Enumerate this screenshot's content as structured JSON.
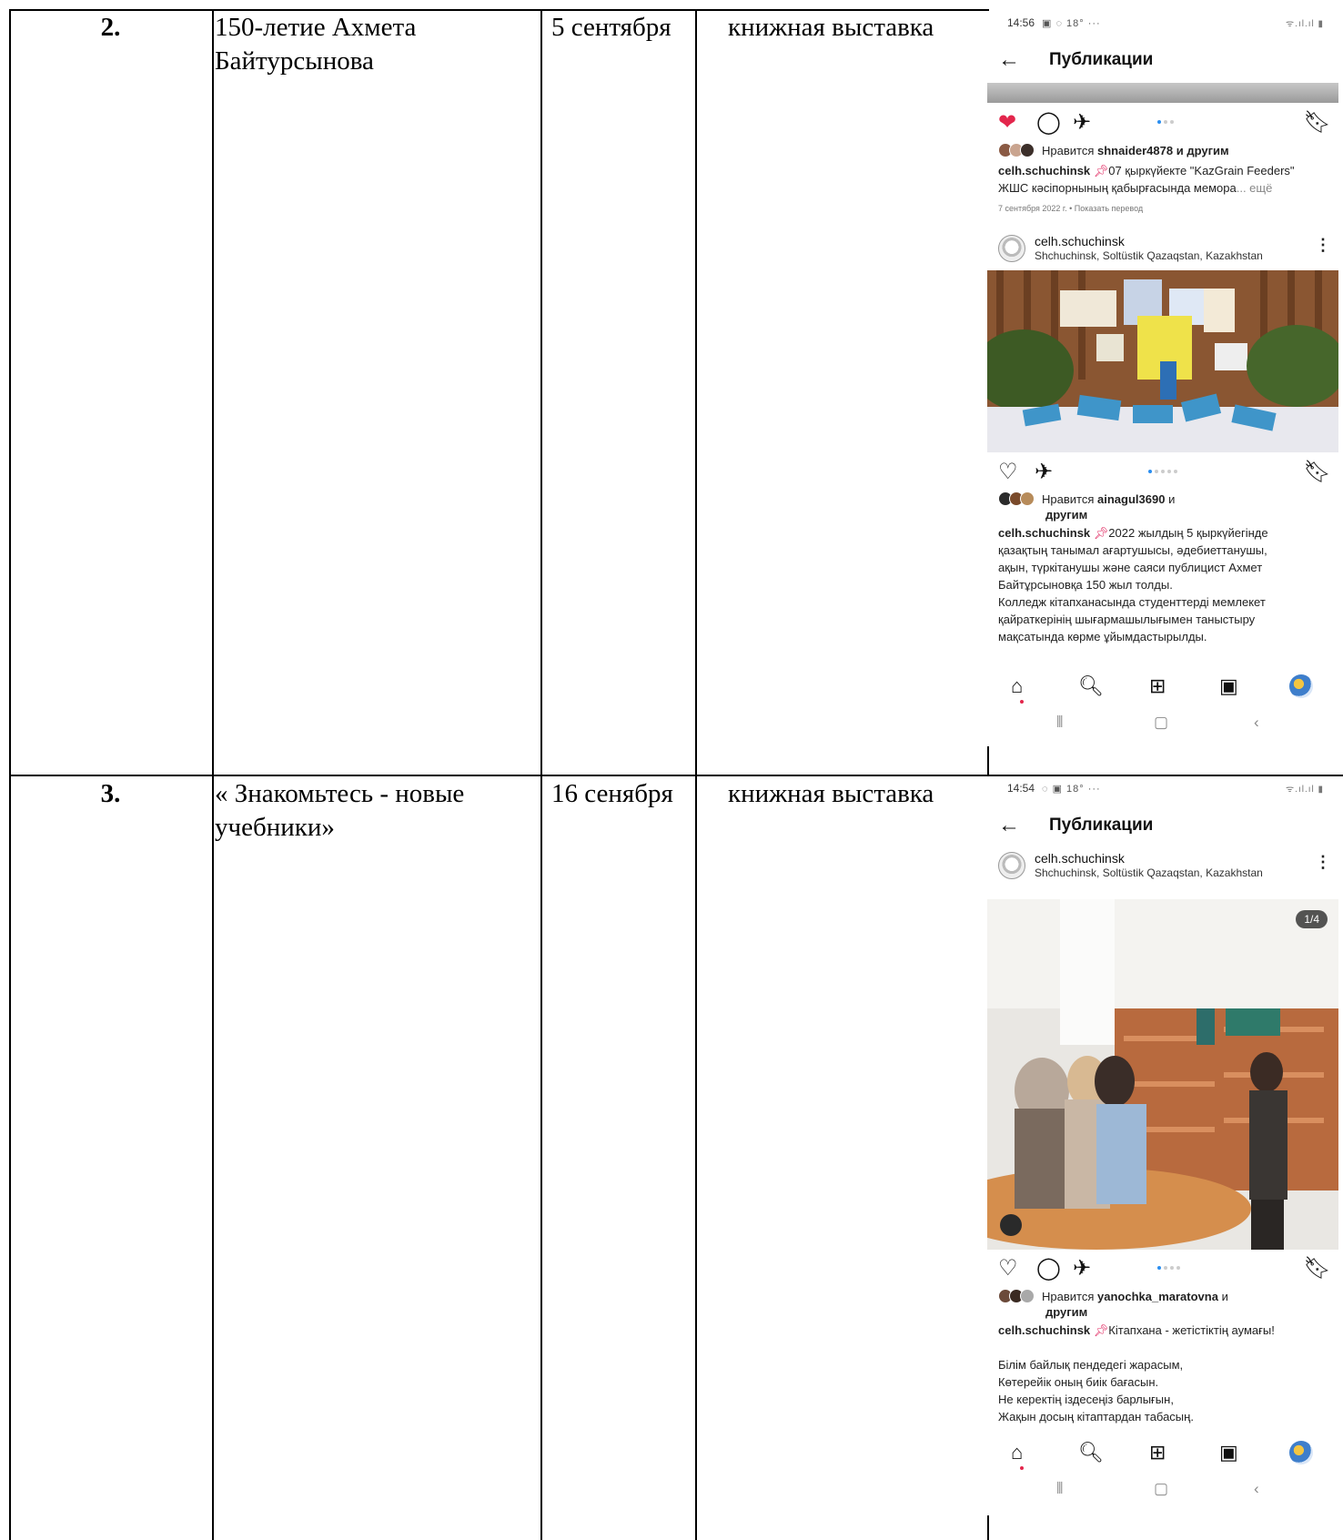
{
  "rows": [
    {
      "number": "2.",
      "event_line1": "150-летие Ахмета",
      "event_line2": "Байтурсынова",
      "date": "5 сентября",
      "form": "книжная выставка",
      "phone": {
        "time": "14:56",
        "status_icons": "▣ ◌ 18° ···",
        "status_right": "ᯤ.ıl.ıl ▮",
        "header_title": "Публикации",
        "prev_post": {
          "likes_prefix": "Нравится",
          "likes_user": "shnaider4878",
          "likes_suffix": "и другим",
          "caption_user": "celh.schuchinsk",
          "caption_line1": "07 қыркүйекте \"KazGrain Feeders\"",
          "caption_line2": "ЖШС кәсіпорнының қабырғасында мемора",
          "caption_more": "... ещё",
          "meta": "7 сентября 2022 г. • Показать перевод"
        },
        "post": {
          "username": "celh.schuchinsk",
          "location": "Shchuchinsk, Soltüstik Qazaqstan, Kazakhstan",
          "likes_prefix": "Нравится",
          "likes_user": "ainagul3690",
          "likes_suffix": "и",
          "likes_line2": "другим",
          "caption_user": "celh.schuchinsk",
          "caption_lines": [
            "2022 жылдың 5 қыркүйегінде",
            "қазақтың танымал ағартушысы, әдебиеттанушы,",
            "ақын, түркітанушы және саяси публицист Ахмет",
            "Байтұрсыновқа 150 жыл толды.",
            "Колледж кітапханасында студенттерді мемлекет",
            "қайраткерінің шығармашылығымен таныстыру",
            "мақсатында көрме ұйымдастырылды."
          ]
        }
      }
    },
    {
      "number": "3.",
      "event_line1": "« Знакомьтесь - новые",
      "event_line2": "учебники»",
      "date": "16 сенября",
      "form": "книжная выставка",
      "phone": {
        "time": "14:54",
        "status_icons": "◌ ▣ 18° ···",
        "status_right": "ᯤ.ıl.ıl ▮",
        "header_title": "Публикации",
        "post": {
          "username": "celh.schuchinsk",
          "location": "Shchuchinsk, Soltüstik Qazaqstan, Kazakhstan",
          "badge": "1/4",
          "likes_prefix": "Нравится",
          "likes_user": "yanochka_maratovna",
          "likes_suffix": "и",
          "likes_line2": "другим",
          "caption_user": "celh.schuchinsk",
          "caption_first": "Кітапхана - жетістіктің аумағы!",
          "caption_lines": [
            "Білім байлық пендедегі жарасым,",
            "Көтерейік оның биік бағасын.",
            "Не керектің іздесеңіз барлығын,",
            "Жақын досың кітаптардан табасың."
          ]
        }
      }
    }
  ],
  "icons": {
    "back": "back-arrow-icon",
    "heart": "heart-icon",
    "comment": "comment-icon",
    "share": "share-icon",
    "bookmark": "bookmark-icon",
    "home": "home-icon",
    "search": "search-icon",
    "create": "create-icon",
    "reels": "reels-icon",
    "profile": "profile-avatar"
  },
  "colors": {
    "liked_heart": "#e3264c",
    "carousel_dot": "#2a8ef0",
    "pin": "#e0245e"
  }
}
